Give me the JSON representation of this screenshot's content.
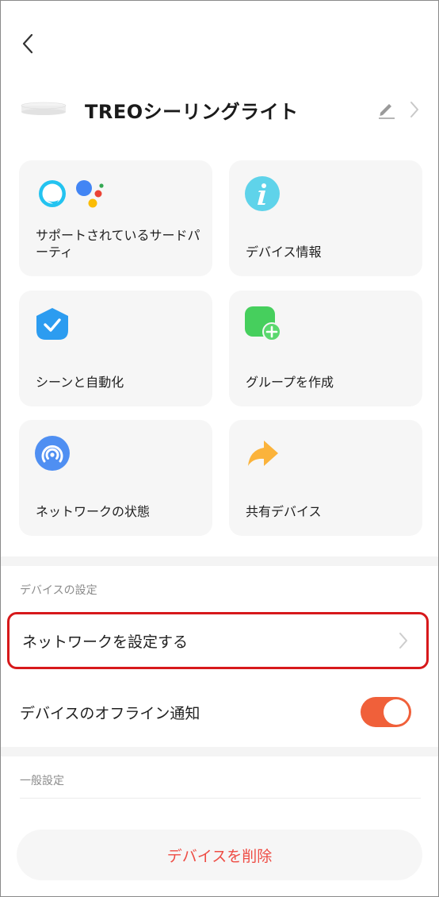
{
  "header": {
    "device_name": "TREOシーリングライト"
  },
  "tiles": [
    {
      "label": "サポートされているサードパーティ",
      "icon": "alexa-google-assistant-icons"
    },
    {
      "label": "デバイス情報",
      "icon": "info-icon"
    },
    {
      "label": "シーンと自動化",
      "icon": "shield-check-icon"
    },
    {
      "label": "グループを作成",
      "icon": "group-add-icon"
    },
    {
      "label": "ネットワークの状態",
      "icon": "network-signal-icon"
    },
    {
      "label": "共有デバイス",
      "icon": "share-arrow-icon"
    }
  ],
  "device_settings": {
    "section_title": "デバイスの設定",
    "network_setup_label": "ネットワークを設定する",
    "offline_notify_label": "デバイスのオフライン通知",
    "offline_notify_on": true
  },
  "general_settings": {
    "section_title": "一般設定"
  },
  "delete_label": "デバイスを削除",
  "colors": {
    "accent": "#f0603a",
    "highlight_border": "#d7191b",
    "delete_text": "#ee4d45",
    "tile_bg": "#f6f6f6"
  }
}
